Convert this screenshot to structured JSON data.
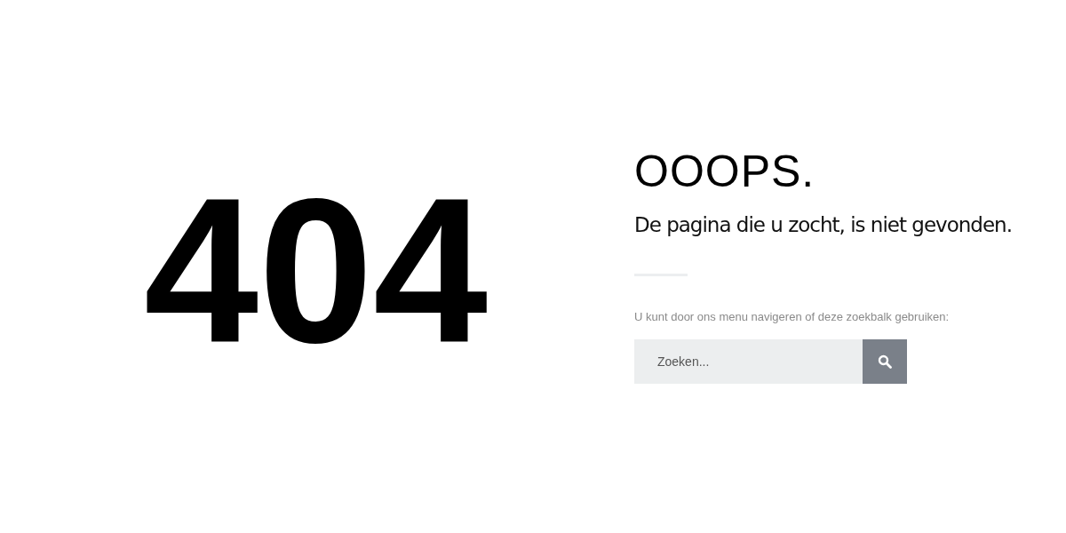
{
  "error_code": "404",
  "heading": "OOOPS.",
  "message": "De pagina die u zocht, is niet gevonden.",
  "hint": "U kunt door ons menu navigeren of deze zoekbalk gebruiken:",
  "search": {
    "placeholder": "Zoeken..."
  }
}
